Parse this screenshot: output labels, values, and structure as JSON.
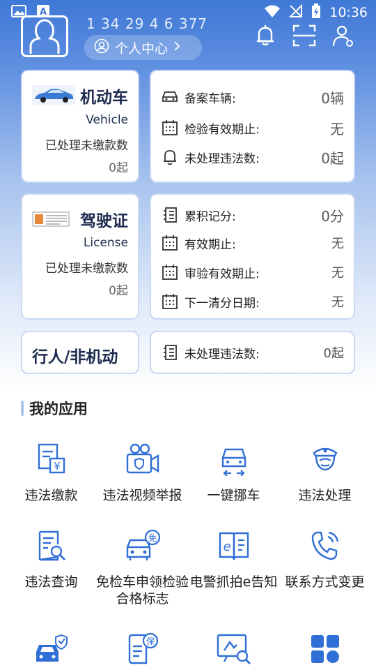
{
  "status_bar": {
    "time": "10:36"
  },
  "header": {
    "phone": "1 34 29 4 6 377",
    "personal_center": "个人中心"
  },
  "motor_vehicle": {
    "title": "机动车",
    "en": "Vehicle",
    "desc": "已处理未缴款数",
    "count": "0起",
    "rows": [
      {
        "icon": "car-icon",
        "label": "备案车辆:",
        "value": "0辆"
      },
      {
        "icon": "calendar-icon",
        "label": "检验有效期止:",
        "value": "无"
      },
      {
        "icon": "bell-icon",
        "label": "未处理违法数:",
        "value": "0起"
      }
    ]
  },
  "license": {
    "title": "驾驶证",
    "en": "License",
    "desc": "已处理未缴款数",
    "count": "0起",
    "rows": [
      {
        "icon": "notebook-icon",
        "label": "累积记分:",
        "value": "0分"
      },
      {
        "icon": "calendar-icon",
        "label": "有效期止:",
        "value": "无"
      },
      {
        "icon": "calendar-icon",
        "label": "审验有效期止:",
        "value": "无"
      },
      {
        "icon": "calendar-icon",
        "label": "下一清分日期:",
        "value": "无"
      }
    ]
  },
  "pedestrian": {
    "title": "行人/非机动",
    "row": {
      "icon": "notebook-icon",
      "label": "未处理违法数:",
      "value": "0起"
    }
  },
  "apps_section": {
    "title": "我的应用",
    "items": [
      {
        "label": "违法缴款",
        "icon": "payment-doc-icon"
      },
      {
        "label": "违法视频举报",
        "icon": "video-camera-icon"
      },
      {
        "label": "一键挪车",
        "icon": "move-car-icon"
      },
      {
        "label": "违法处理",
        "icon": "police-icon"
      },
      {
        "label": "违法查询",
        "icon": "doc-search-icon"
      },
      {
        "label": "免检车申领检验合格标志",
        "icon": "exempt-car-icon"
      },
      {
        "label": "电警抓拍e告知",
        "icon": "e-notice-icon"
      },
      {
        "label": "联系方式变更",
        "icon": "phone-icon"
      },
      {
        "label": "",
        "icon": "car-shield-icon"
      },
      {
        "label": "",
        "icon": "insurance-doc-icon"
      },
      {
        "label": "",
        "icon": "screen-search-icon"
      },
      {
        "label": "",
        "icon": "grid-apps-icon"
      }
    ]
  },
  "colors": {
    "primary": "#2f6fd6",
    "card_border": "#c9d8f4"
  }
}
